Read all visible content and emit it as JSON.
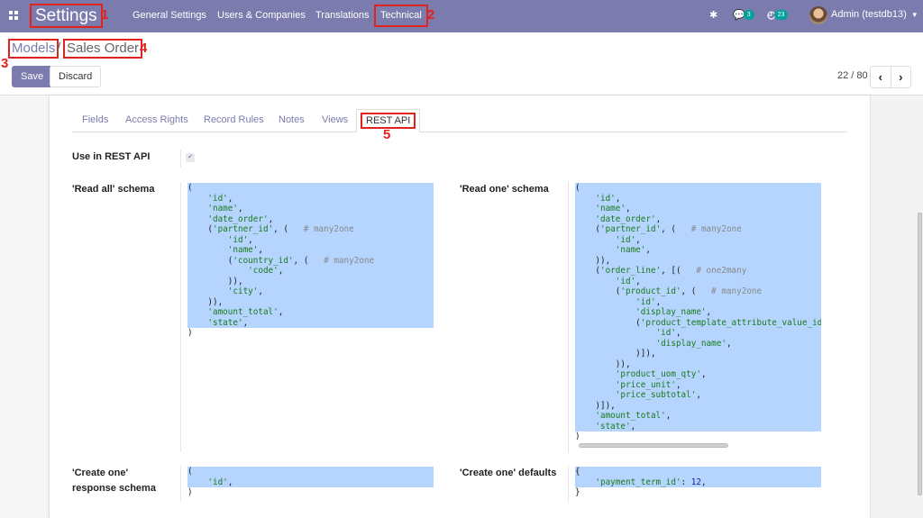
{
  "navbar": {
    "app_title": "Settings",
    "menu": [
      "General Settings",
      "Users & Companies",
      "Translations",
      "Technical"
    ],
    "messages_count": "3",
    "activities_count": "23",
    "user": "Admin (testdb13)",
    "icons": {
      "apps": "apps-grid-icon",
      "debug": "bug-icon",
      "messages": "chat-icon",
      "activities": "clock-icon",
      "user_menu": "caret-down-icon"
    }
  },
  "annotations": [
    "1",
    "2",
    "3",
    "4",
    "5"
  ],
  "breadcrumb": {
    "parent": "Models",
    "separator": "/",
    "current": "Sales Order"
  },
  "toolbar": {
    "save_label": "Save",
    "discard_label": "Discard"
  },
  "pager": {
    "value": "22 / 80",
    "prev": "‹",
    "next": "›"
  },
  "tabs": [
    "Fields",
    "Access Rights",
    "Record Rules",
    "Notes",
    "Views",
    "REST API"
  ],
  "active_tab": "REST API",
  "form": {
    "use_in_rest_api": {
      "label": "Use in REST API",
      "checked": true,
      "check_glyph": "✔"
    },
    "read_all_schema": {
      "label": "'Read all' schema"
    },
    "read_one_schema": {
      "label": "'Read one' schema"
    },
    "create_one_response": {
      "label_line1": "'Create one'",
      "label_line2": "response schema"
    },
    "create_one_defaults": {
      "label": "'Create one' defaults"
    }
  },
  "colors": {
    "navbar": "#7c7bad",
    "annotation": "#e0231e",
    "selection": "#b5d5ff",
    "badge": "#00a09d"
  }
}
